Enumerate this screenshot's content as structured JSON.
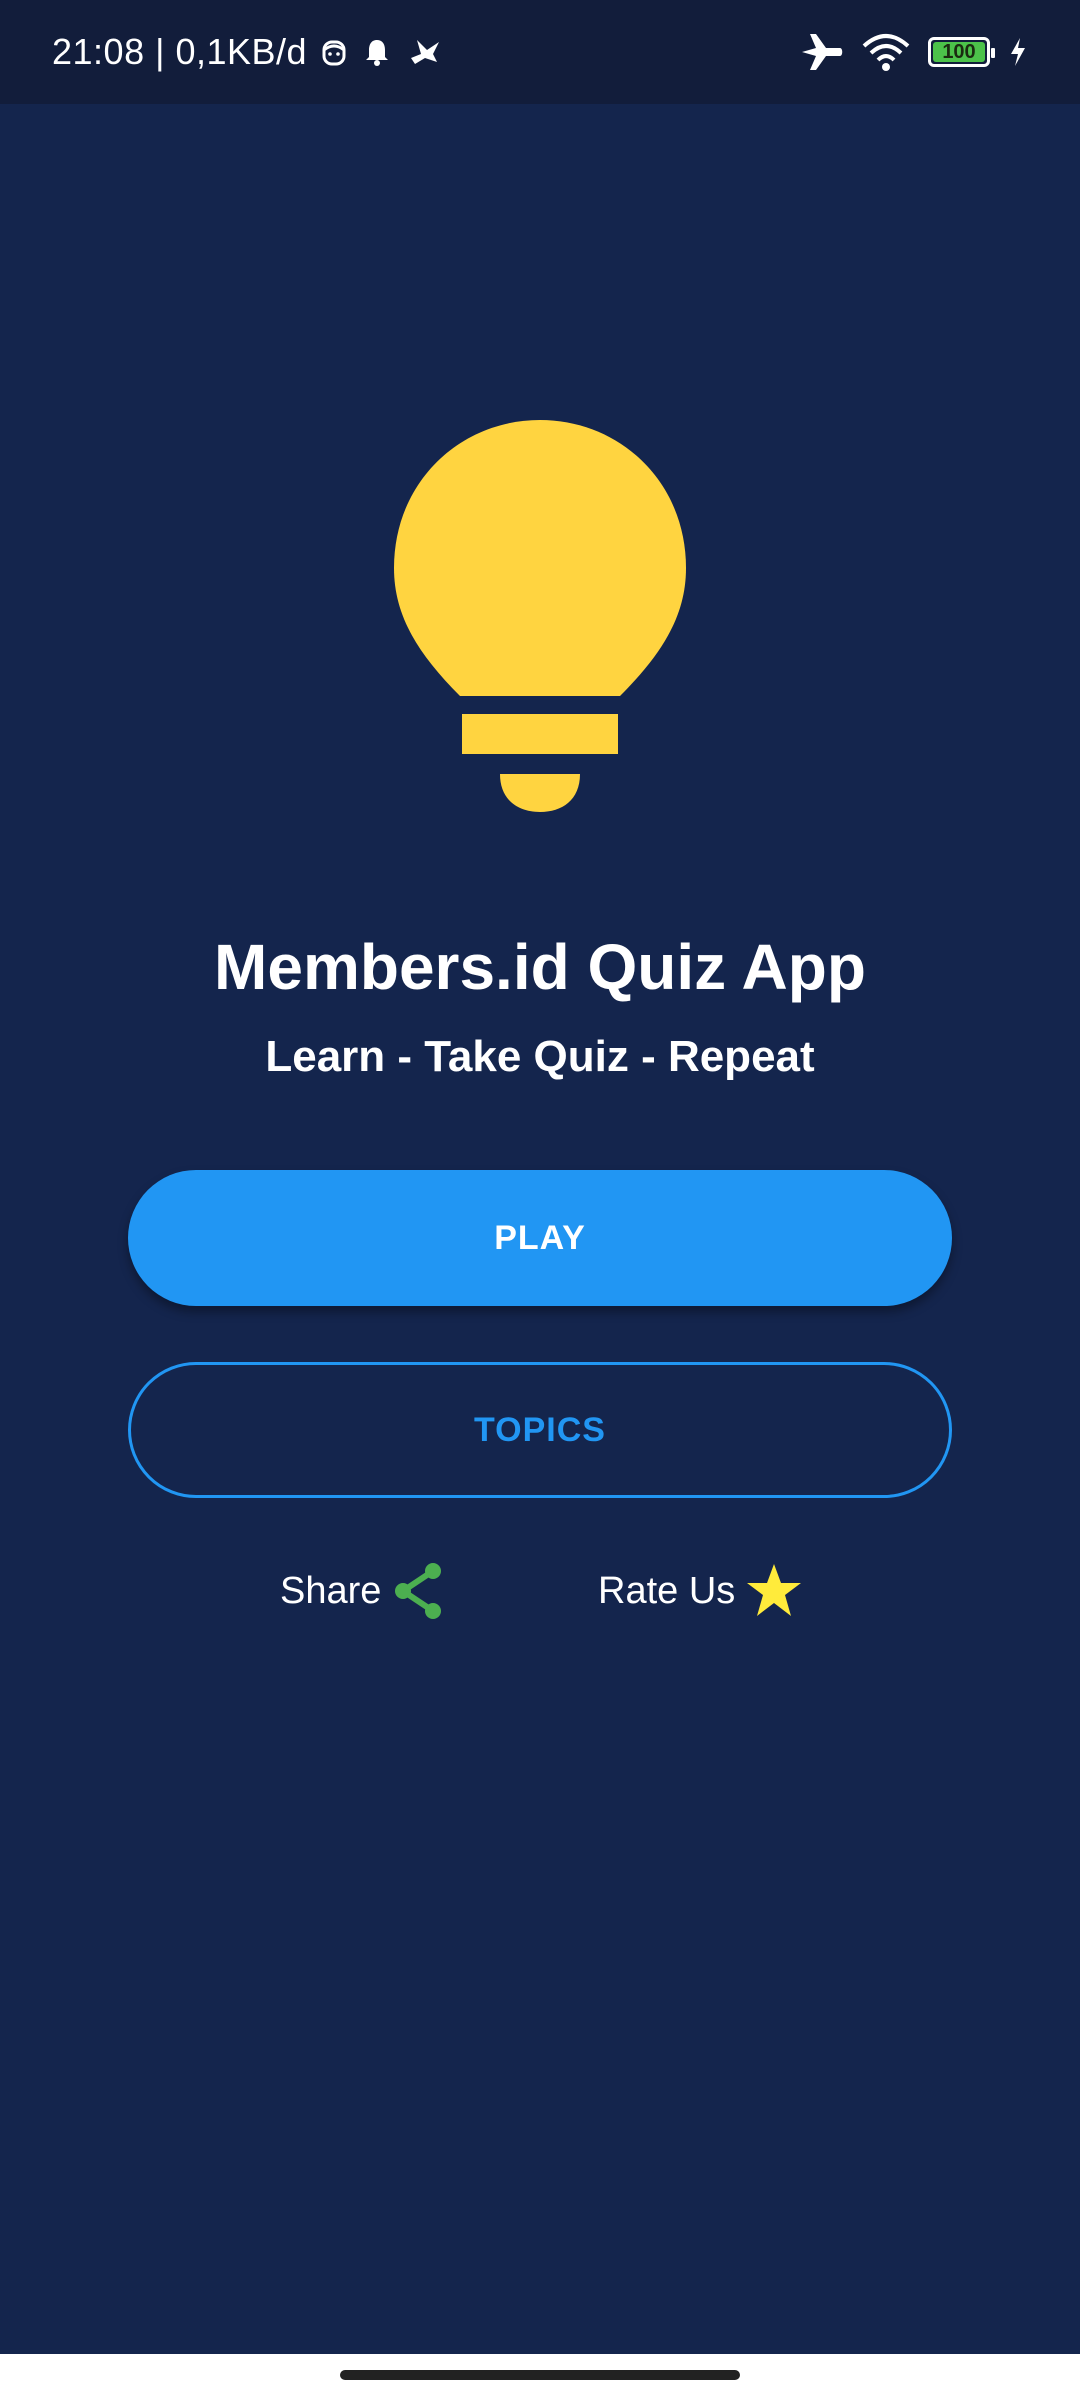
{
  "status_bar": {
    "time_info": "21:08 | 0,1KB/d",
    "left_icons": [
      "face-icon",
      "bell-icon",
      "bird-icon"
    ],
    "right_icons": [
      "airplane-icon",
      "wifi-icon",
      "battery-icon",
      "charging-icon"
    ],
    "battery_level": "100",
    "battery_fraction": 1.0
  },
  "app": {
    "title": "Members.id Quiz App",
    "subtitle": "Learn - Take Quiz - Repeat",
    "logo_icon": "lightbulb-icon"
  },
  "buttons": {
    "play_label": "PLAY",
    "topics_label": "TOPICS"
  },
  "actions": {
    "share_label": "Share",
    "share_icon": "share-icon",
    "rate_label": "Rate Us",
    "rate_icon": "star-icon"
  },
  "colors": {
    "background": "#14254d",
    "status_bar": "#121d3b",
    "accent_blue": "#2196f3",
    "bulb_yellow": "#ffd440",
    "share_green": "#4caf50",
    "star_yellow": "#ffeb3b"
  }
}
